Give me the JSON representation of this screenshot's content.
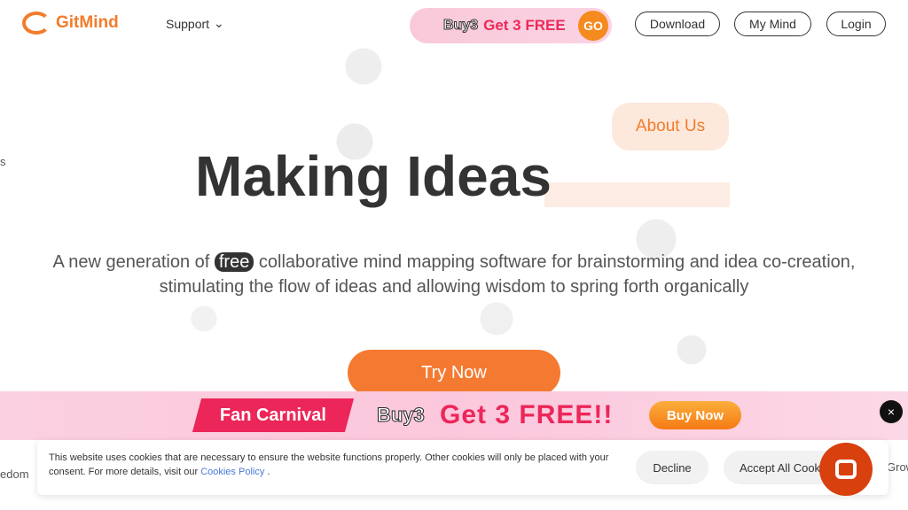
{
  "header": {
    "logo": "GitMind",
    "support": "Support",
    "promo": {
      "buy3": "Buy3",
      "get3": "Get 3 FREE",
      "go": "GO"
    },
    "download": "Download",
    "my_mind": "My Mind",
    "login": "Login"
  },
  "hero": {
    "about": "About Us",
    "title": "Making Ideas",
    "sub_before": "A new generation of",
    "free": "free",
    "sub_after": "collaborative mind mapping software for brainstorming and idea co-creation,",
    "sub_line2": "stimulating the flow of ideas and allowing wisdom to spring forth organically",
    "try": "Try Now",
    "side_left": "s",
    "side_left2": "edom",
    "side_right": "Grow"
  },
  "banner": {
    "fan": "Fan Carnival",
    "buy3": "Buy3",
    "get3": "Get 3 FREE!!",
    "buy_now": "Buy Now",
    "close": "×"
  },
  "cookie": {
    "text": "This website uses cookies that are necessary to ensure the website functions properly. Other cookies will only be placed with your consent. For more details, visit our",
    "link": "Cookies Policy",
    "end": " .",
    "decline": "Decline",
    "accept": "Accept All Cookies"
  }
}
